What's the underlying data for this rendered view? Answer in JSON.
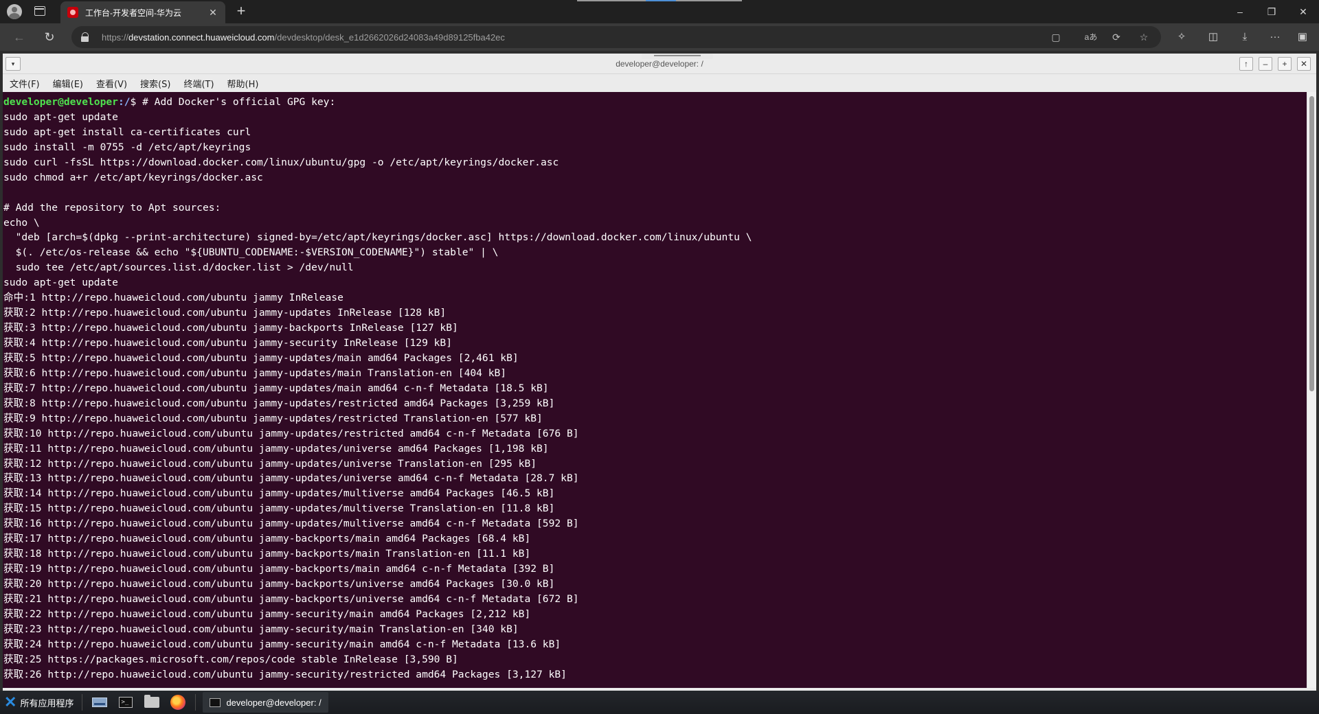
{
  "browser": {
    "tab_title": "工作台-开发者空间-华为云",
    "tab_close": "✕",
    "new_tab": "+",
    "url_scheme": "https://",
    "url_host": "devstation.connect.huaweicloud.com",
    "url_path": "/devdesktop/desk_e1d2662026d24083a49d89125fba42ec",
    "window_controls": {
      "minimize": "–",
      "restore": "❐",
      "close": "✕"
    },
    "nav": {
      "back": "←",
      "reload": "↻"
    },
    "toolbar_icons": {
      "sidebar": "▢",
      "read_aloud": "aあ",
      "refresh_page": "⟳",
      "favorite": "☆",
      "extensions": "✧",
      "split_screen": "◫",
      "downloads": "⤓",
      "more": "···",
      "sidebar_toggle": "▣"
    }
  },
  "terminal": {
    "window_title": "developer@developer: /",
    "menu_dropdown": "▾",
    "window_buttons": {
      "up": "↑",
      "minimize": "–",
      "maximize": "+",
      "close": "✕"
    },
    "menu": [
      "文件(F)",
      "编辑(E)",
      "查看(V)",
      "搜索(S)",
      "终端(T)",
      "帮助(H)"
    ],
    "prompt_user": "developer@developer",
    "prompt_path": ":/",
    "prompt_rest": "$ # Add Docker's official GPG key:",
    "lines": [
      "sudo apt-get update",
      "sudo apt-get install ca-certificates curl",
      "sudo install -m 0755 -d /etc/apt/keyrings",
      "sudo curl -fsSL https://download.docker.com/linux/ubuntu/gpg -o /etc/apt/keyrings/docker.asc",
      "sudo chmod a+r /etc/apt/keyrings/docker.asc",
      "",
      "# Add the repository to Apt sources:",
      "echo \\",
      "  \"deb [arch=$(dpkg --print-architecture) signed-by=/etc/apt/keyrings/docker.asc] https://download.docker.com/linux/ubuntu \\",
      "  $(. /etc/os-release && echo \"${UBUNTU_CODENAME:-$VERSION_CODENAME}\") stable\" | \\",
      "  sudo tee /etc/apt/sources.list.d/docker.list > /dev/null",
      "sudo apt-get update",
      "命中:1 http://repo.huaweicloud.com/ubuntu jammy InRelease",
      "获取:2 http://repo.huaweicloud.com/ubuntu jammy-updates InRelease [128 kB]",
      "获取:3 http://repo.huaweicloud.com/ubuntu jammy-backports InRelease [127 kB]",
      "获取:4 http://repo.huaweicloud.com/ubuntu jammy-security InRelease [129 kB]",
      "获取:5 http://repo.huaweicloud.com/ubuntu jammy-updates/main amd64 Packages [2,461 kB]",
      "获取:6 http://repo.huaweicloud.com/ubuntu jammy-updates/main Translation-en [404 kB]",
      "获取:7 http://repo.huaweicloud.com/ubuntu jammy-updates/main amd64 c-n-f Metadata [18.5 kB]",
      "获取:8 http://repo.huaweicloud.com/ubuntu jammy-updates/restricted amd64 Packages [3,259 kB]",
      "获取:9 http://repo.huaweicloud.com/ubuntu jammy-updates/restricted Translation-en [577 kB]",
      "获取:10 http://repo.huaweicloud.com/ubuntu jammy-updates/restricted amd64 c-n-f Metadata [676 B]",
      "获取:11 http://repo.huaweicloud.com/ubuntu jammy-updates/universe amd64 Packages [1,198 kB]",
      "获取:12 http://repo.huaweicloud.com/ubuntu jammy-updates/universe Translation-en [295 kB]",
      "获取:13 http://repo.huaweicloud.com/ubuntu jammy-updates/universe amd64 c-n-f Metadata [28.7 kB]",
      "获取:14 http://repo.huaweicloud.com/ubuntu jammy-updates/multiverse amd64 Packages [46.5 kB]",
      "获取:15 http://repo.huaweicloud.com/ubuntu jammy-updates/multiverse Translation-en [11.8 kB]",
      "获取:16 http://repo.huaweicloud.com/ubuntu jammy-updates/multiverse amd64 c-n-f Metadata [592 B]",
      "获取:17 http://repo.huaweicloud.com/ubuntu jammy-backports/main amd64 Packages [68.4 kB]",
      "获取:18 http://repo.huaweicloud.com/ubuntu jammy-backports/main Translation-en [11.1 kB]",
      "获取:19 http://repo.huaweicloud.com/ubuntu jammy-backports/main amd64 c-n-f Metadata [392 B]",
      "获取:20 http://repo.huaweicloud.com/ubuntu jammy-backports/universe amd64 Packages [30.0 kB]",
      "获取:21 http://repo.huaweicloud.com/ubuntu jammy-backports/universe amd64 c-n-f Metadata [672 B]",
      "获取:22 http://repo.huaweicloud.com/ubuntu jammy-security/main amd64 Packages [2,212 kB]",
      "获取:23 http://repo.huaweicloud.com/ubuntu jammy-security/main Translation-en [340 kB]",
      "获取:24 http://repo.huaweicloud.com/ubuntu jammy-security/main amd64 c-n-f Metadata [13.6 kB]",
      "获取:25 https://packages.microsoft.com/repos/code stable InRelease [3,590 B]",
      "获取:26 http://repo.huaweicloud.com/ubuntu jammy-security/restricted amd64 Packages [3,127 kB]"
    ]
  },
  "taskbar": {
    "start_label": "所有应用程序",
    "start_glyph": "✕",
    "term_glyph": ">_",
    "active_window": "developer@developer: /"
  },
  "colors": {
    "terminal_bg": "#300a24",
    "prompt_user": "#4fe34f",
    "prompt_path": "#8ab4f8",
    "brand": "#c7000b"
  }
}
